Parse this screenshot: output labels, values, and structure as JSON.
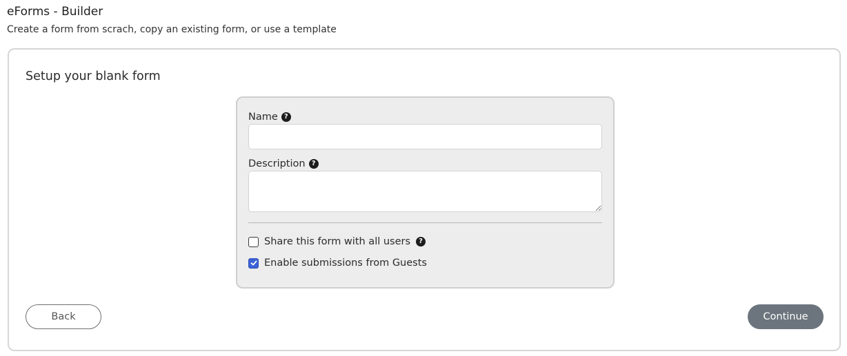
{
  "header": {
    "title": "eForms - Builder",
    "subtitle": "Create a form from scrach, copy an existing form, or use a template"
  },
  "card": {
    "title": "Setup your blank form"
  },
  "form": {
    "name_label": "Name",
    "name_value": "",
    "description_label": "Description",
    "description_value": "",
    "share_label": "Share this form with all users",
    "share_checked": false,
    "guests_label": "Enable submissions from Guests",
    "guests_checked": true
  },
  "help_icon": "question-circle-icon",
  "buttons": {
    "back_label": "Back",
    "continue_label": "Continue"
  },
  "colors": {
    "checkbox_checked": "#3b63d6",
    "continue_button": "#6c757d",
    "panel_background": "#ededed"
  }
}
